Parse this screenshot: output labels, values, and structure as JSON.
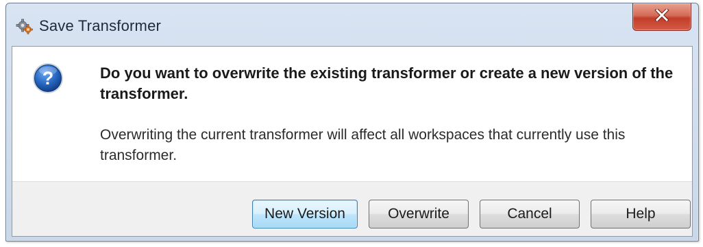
{
  "window": {
    "title": "Save Transformer",
    "app_icon": "transformer-gear-icon",
    "close_icon": "close-icon",
    "close_color": "#c9442f"
  },
  "message": {
    "icon": "question-icon",
    "main_instruction": "Do you want to overwrite the existing transformer or create a new version of the transformer.",
    "content": "Overwriting the current transformer will affect all workspaces that currently use this transformer."
  },
  "buttons": {
    "new_version": "New Version",
    "overwrite": "Overwrite",
    "cancel": "Cancel",
    "help": "Help"
  },
  "colors": {
    "default_button_border": "#3c7fb1",
    "question_icon_blue": "#1f5fb8"
  }
}
